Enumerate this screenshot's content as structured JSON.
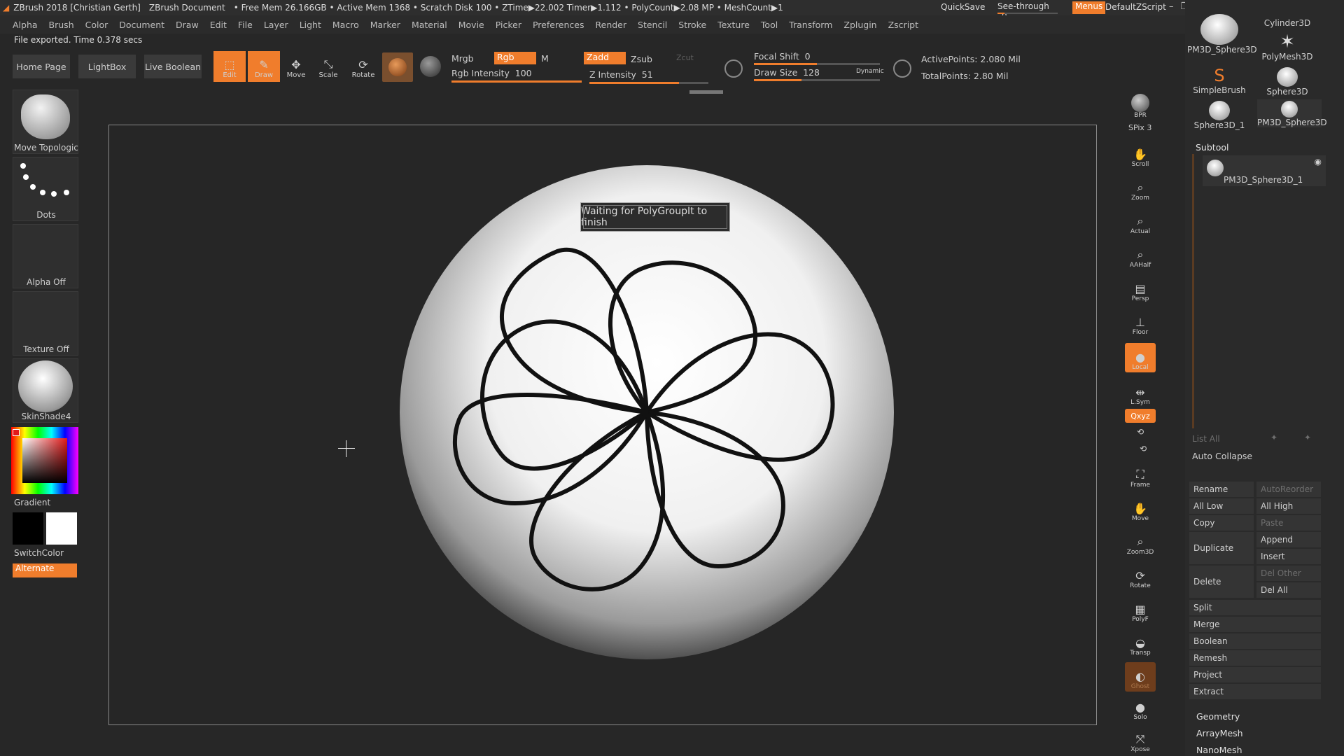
{
  "titlebar": {
    "app": "ZBrush 2018 [Christian Gerth]",
    "doc": "ZBrush Document",
    "stats": "• Free Mem 26.166GB • Active Mem 1368 • Scratch Disk 100 • ZTime▶22.002 Timer▶1.112 • PolyCount▶2.08 MP • MeshCount▶1",
    "quicksave": "QuickSave",
    "seethrough": "See-through",
    "seethrough_val": "0",
    "menus": "Menus",
    "defaultzscript": "DefaultZScript"
  },
  "menu": [
    "Alpha",
    "Brush",
    "Color",
    "Document",
    "Draw",
    "Edit",
    "File",
    "Layer",
    "Light",
    "Macro",
    "Marker",
    "Material",
    "Movie",
    "Picker",
    "Preferences",
    "Render",
    "Stencil",
    "Stroke",
    "Texture",
    "Tool",
    "Transform",
    "Zplugin",
    "Zscript"
  ],
  "status": "File exported. Time 0.378 secs",
  "top": {
    "home": "Home Page",
    "lightbox": "LightBox",
    "liveboolean": "Live Boolean",
    "edit": "Edit",
    "draw": "Draw",
    "move": "Move",
    "scale": "Scale",
    "rotate": "Rotate",
    "mrgb": "Mrgb",
    "rgb": "Rgb",
    "m": "M",
    "zadd": "Zadd",
    "zsub": "Zsub",
    "zcut": "Zcut",
    "rgb_intensity_label": "Rgb Intensity",
    "rgb_intensity": "100",
    "z_intensity_label": "Z Intensity",
    "z_intensity": "51",
    "focal_label": "Focal Shift",
    "focal": "0",
    "drawsize_label": "Draw Size",
    "drawsize": "128",
    "dynamic": "Dynamic",
    "active_points": "ActivePoints: 2.080 Mil",
    "total_points": "TotalPoints: 2.80 Mil"
  },
  "left": {
    "brush": "Move Topologic",
    "stroke": "Dots",
    "alpha": "Alpha Off",
    "texture": "Texture Off",
    "material": "SkinShade4",
    "gradient": "Gradient",
    "switchcolor": "SwitchColor",
    "alternate": "Alternate"
  },
  "canvas": {
    "message": "Waiting for PolyGroupIt to finish"
  },
  "shelf": {
    "bpr": "BPR",
    "spix": "SPix 3",
    "scroll": "Scroll",
    "zoom": "Zoom",
    "actual": "Actual",
    "aahalf": "AAHalf",
    "persp": "Persp",
    "floor": "Floor",
    "local": "Local",
    "lsym": "L.Sym",
    "xyz": "Qxyz",
    "frame": "Frame",
    "move": "Move",
    "zoom3d": "Zoom3D",
    "rotate": "Rotate",
    "polyf": "PolyF",
    "transp": "Transp",
    "ghost": "Ghost",
    "solo": "Solo",
    "xpose": "Xpose"
  },
  "right": {
    "tools": [
      "Cylinder3D",
      "PM3D_Sphere3D",
      "PolyMesh3D",
      "SimpleBrush",
      "Sphere3D",
      "Sphere3D_1",
      "PM3D_Sphere3D"
    ],
    "subtool_header": "Subtool",
    "subtool_item": "PM3D_Sphere3D_1",
    "list_all": "List All",
    "auto_collapse": "Auto Collapse",
    "rename": "Rename",
    "autoreorder": "AutoReorder",
    "all_low": "All Low",
    "all_high": "All High",
    "copy": "Copy",
    "paste": "Paste",
    "duplicate": "Duplicate",
    "append": "Append",
    "insert": "Insert",
    "delete": "Delete",
    "del_other": "Del Other",
    "del_all": "Del All",
    "split": "Split",
    "merge": "Merge",
    "boolean": "Boolean",
    "remesh": "Remesh",
    "project": "Project",
    "extract": "Extract",
    "geometry": "Geometry",
    "arraymesh": "ArrayMesh",
    "nanomesh": "NanoMesh"
  },
  "colors": {
    "accent": "#f07d2c",
    "bg": "#272727"
  }
}
